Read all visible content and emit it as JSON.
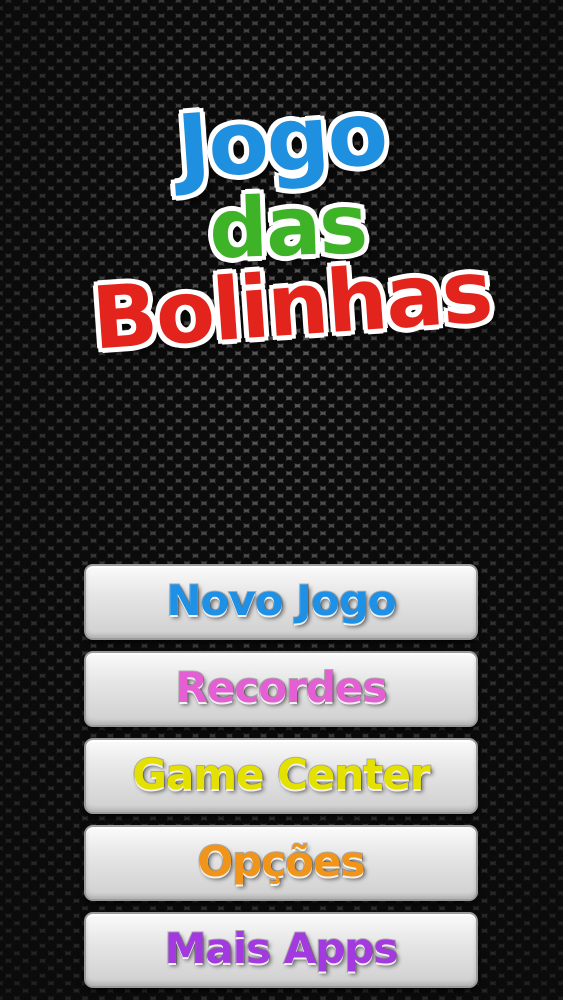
{
  "logo": {
    "line1": "Jogo",
    "line2": "das",
    "line3": "Bolinhas"
  },
  "menu": {
    "items": [
      {
        "label": "Novo Jogo",
        "color": "#1e90e6"
      },
      {
        "label": "Recordes",
        "color": "#e45fd4"
      },
      {
        "label": "Game Center",
        "color": "#e4e000"
      },
      {
        "label": "Opções",
        "color": "#f0941a"
      },
      {
        "label": "Mais Apps",
        "color": "#a23ae0"
      }
    ]
  },
  "colors": {
    "logo_blue": "#1f8fe0",
    "logo_green": "#3fb327",
    "logo_red": "#e2241d",
    "background": "#2a2a2a"
  }
}
